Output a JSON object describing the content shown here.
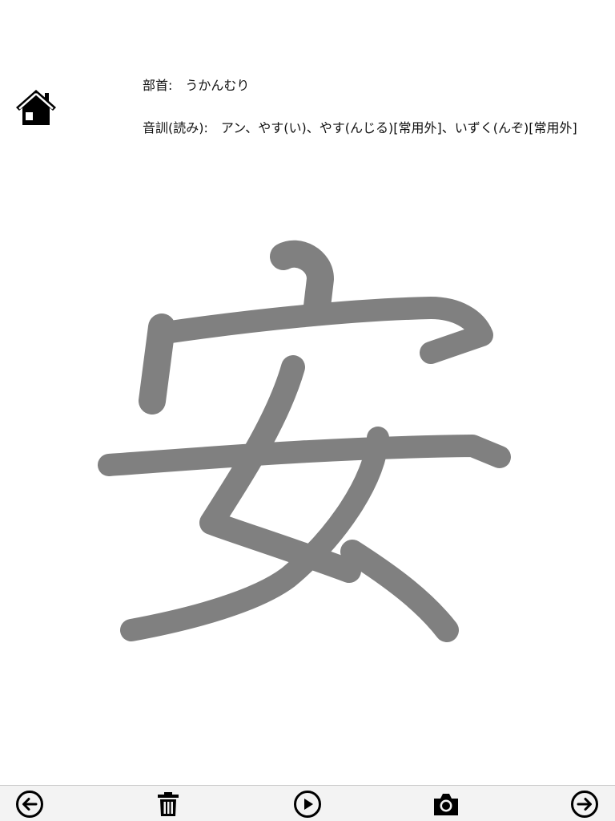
{
  "header": {
    "home_icon": "home-icon"
  },
  "info": {
    "radical_label": "部首:",
    "radical_value": "うかんむり",
    "reading_label": "音訓(読み):",
    "reading_value": "アン、やす(い)、やす(んじる)[常用外]、いずく(んぞ)[常用外]"
  },
  "character": {
    "glyph": "安",
    "stroke_color": "#808080"
  },
  "toolbar": {
    "buttons": [
      {
        "icon": "arrow-left-circle-icon"
      },
      {
        "icon": "trash-icon"
      },
      {
        "icon": "play-circle-icon"
      },
      {
        "icon": "camera-icon"
      },
      {
        "icon": "arrow-right-circle-icon"
      }
    ]
  }
}
